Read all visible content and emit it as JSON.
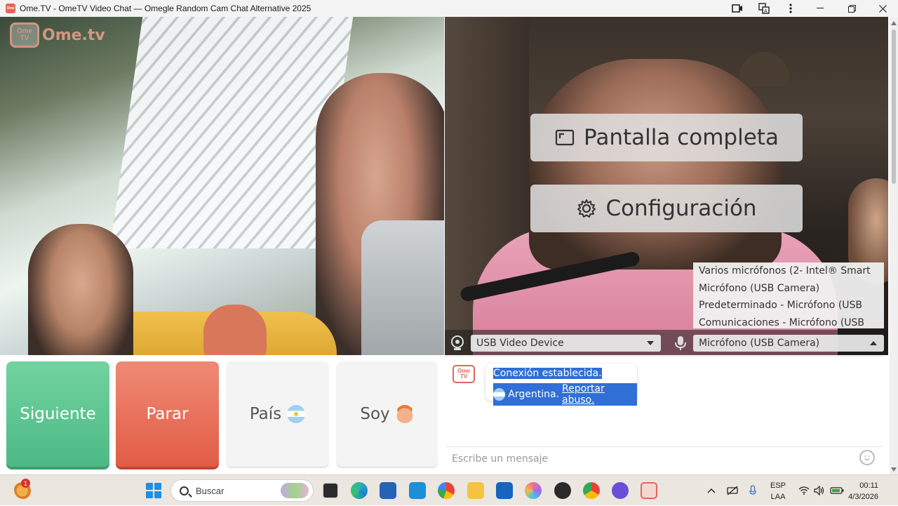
{
  "window": {
    "title": "Ome.TV - OmeTV Video Chat — Omegle Random Cam Chat Alternative 2025",
    "app_icon_text": "Ome"
  },
  "logo": {
    "icon_text": "Ome TV",
    "text": "Ome.tv"
  },
  "overlay": {
    "fullscreen_label": "Pantalla completa",
    "settings_label": "Configuración"
  },
  "devices": {
    "camera_selected": "USB Video Device",
    "mic_selected": "Micrófono (USB Camera)",
    "mic_options": [
      "Varios micrófonos (2- Intel® Smart",
      "Micrófono (USB Camera)",
      "Predeterminado - Micrófono (USB",
      "Comunicaciones - Micrófono (USB"
    ]
  },
  "controls": {
    "next_label": "Siguiente",
    "stop_label": "Parar",
    "country_label": "País",
    "gender_label": "Soy"
  },
  "chat": {
    "logo_text": "Ome TV",
    "connection_msg": "Conexión establecida.",
    "country_name": "Argentina.",
    "report_link": "Reportar abuso.",
    "input_placeholder": "Escribe un mensaje"
  },
  "taskbar": {
    "notification_count": "1",
    "search_placeholder": "Buscar",
    "lang_line1": "ESP",
    "lang_line2": "LAA",
    "time": "00:11",
    "date": "4/3/2026"
  },
  "colors": {
    "next_button": "#4cb984",
    "stop_button": "#e25c45",
    "selection": "#2f6fd6",
    "brand": "#e7645a"
  }
}
